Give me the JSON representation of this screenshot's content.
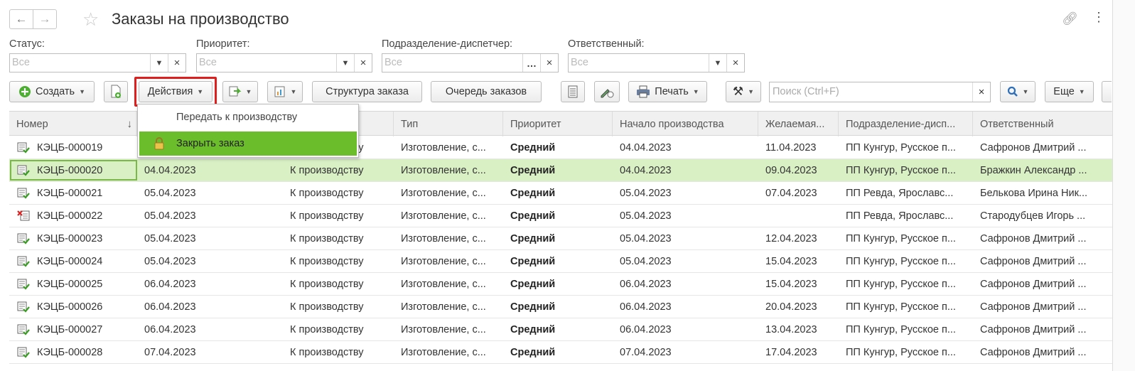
{
  "title": "Заказы на производство",
  "filters": [
    {
      "label": "Статус:",
      "placeholder": "Все"
    },
    {
      "label": "Приоритет:",
      "placeholder": "Все"
    },
    {
      "label": "Подразделение-диспетчер:",
      "placeholder": "Все"
    },
    {
      "label": "Ответственный:",
      "placeholder": "Все"
    }
  ],
  "toolbar": {
    "create": "Создать",
    "actions": "Действия",
    "structure": "Структура заказа",
    "queue": "Очередь заказов",
    "print": "Печать",
    "search_placeholder": "Поиск (Ctrl+F)",
    "more": "Еще"
  },
  "menu": {
    "item1": "Передать к производству",
    "item2": "Закрыть заказ"
  },
  "columns": [
    "Номер",
    "",
    "",
    "Тип",
    "Приоритет",
    "Начало производства",
    "Желаемая...",
    "Подразделение-дисп...",
    "Ответственный"
  ],
  "rows": [
    {
      "num": "КЭЦБ-000019",
      "date": "",
      "status": "К производству",
      "type": "Изготовление, с...",
      "prio": "Средний",
      "start": "04.04.2023",
      "desired": "11.04.2023",
      "dept": "ПП Кунгур, Русское п...",
      "resp": "Сафронов Дмитрий ...",
      "icon": "check"
    },
    {
      "num": "КЭЦБ-000020",
      "date": "04.04.2023",
      "status": "К производству",
      "type": "Изготовление, с...",
      "prio": "Средний",
      "start": "04.04.2023",
      "desired": "09.04.2023",
      "dept": "ПП Кунгур, Русское п...",
      "resp": "Бражкин Александр ...",
      "icon": "check"
    },
    {
      "num": "КЭЦБ-000021",
      "date": "05.04.2023",
      "status": "К производству",
      "type": "Изготовление, с...",
      "prio": "Средний",
      "start": "05.04.2023",
      "desired": "07.04.2023",
      "dept": "ПП Ревда, Ярославс...",
      "resp": "Белькова Ирина Ник...",
      "icon": "check"
    },
    {
      "num": "КЭЦБ-000022",
      "date": "05.04.2023",
      "status": "К производству",
      "type": "Изготовление, с...",
      "prio": "Средний",
      "start": "05.04.2023",
      "desired": "",
      "dept": "ПП Ревда, Ярославс...",
      "resp": "Стародубцев Игорь ...",
      "icon": "cross"
    },
    {
      "num": "КЭЦБ-000023",
      "date": "05.04.2023",
      "status": "К производству",
      "type": "Изготовление, с...",
      "prio": "Средний",
      "start": "05.04.2023",
      "desired": "12.04.2023",
      "dept": "ПП Кунгур, Русское п...",
      "resp": "Сафронов Дмитрий ...",
      "icon": "check"
    },
    {
      "num": "КЭЦБ-000024",
      "date": "05.04.2023",
      "status": "К производству",
      "type": "Изготовление, с...",
      "prio": "Средний",
      "start": "05.04.2023",
      "desired": "15.04.2023",
      "dept": "ПП Кунгур, Русское п...",
      "resp": "Сафронов Дмитрий ...",
      "icon": "check"
    },
    {
      "num": "КЭЦБ-000025",
      "date": "06.04.2023",
      "status": "К производству",
      "type": "Изготовление, с...",
      "prio": "Средний",
      "start": "06.04.2023",
      "desired": "15.04.2023",
      "dept": "ПП Кунгур, Русское п...",
      "resp": "Сафронов Дмитрий ...",
      "icon": "check"
    },
    {
      "num": "КЭЦБ-000026",
      "date": "06.04.2023",
      "status": "К производству",
      "type": "Изготовление, с...",
      "prio": "Средний",
      "start": "06.04.2023",
      "desired": "20.04.2023",
      "dept": "ПП Кунгур, Русское п...",
      "resp": "Сафронов Дмитрий ...",
      "icon": "check"
    },
    {
      "num": "КЭЦБ-000027",
      "date": "06.04.2023",
      "status": "К производству",
      "type": "Изготовление, с...",
      "prio": "Средний",
      "start": "06.04.2023",
      "desired": "13.04.2023",
      "dept": "ПП Кунгур, Русское п...",
      "resp": "Сафронов Дмитрий ...",
      "icon": "check"
    },
    {
      "num": "КЭЦБ-000028",
      "date": "07.04.2023",
      "status": "К производству",
      "type": "Изготовление, с...",
      "prio": "Средний",
      "start": "07.04.2023",
      "desired": "17.04.2023",
      "dept": "ПП Кунгур, Русское п...",
      "resp": "Сафронов Дмитрий ...",
      "icon": "check"
    }
  ],
  "selected_row": 1
}
